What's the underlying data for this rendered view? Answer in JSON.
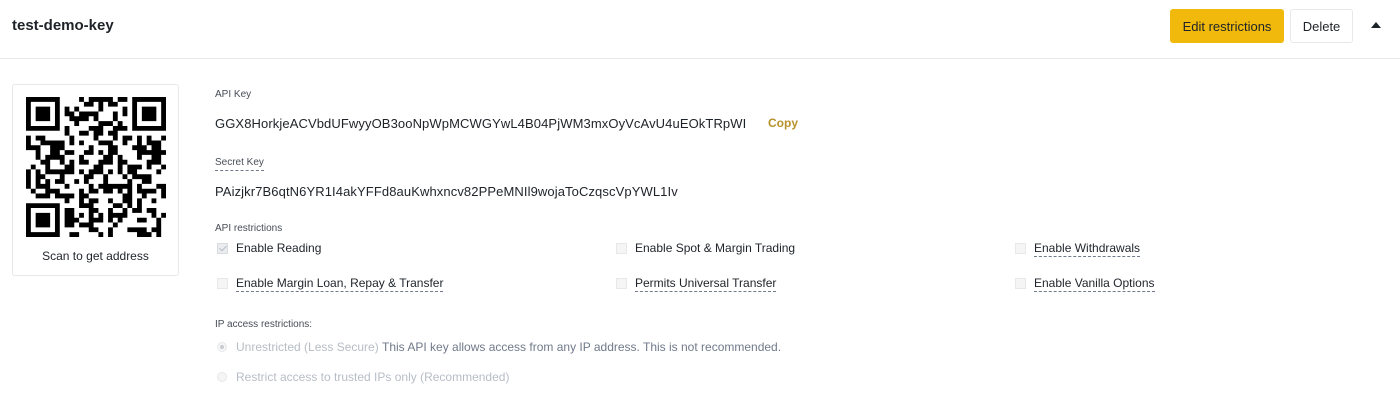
{
  "header": {
    "title": "test-demo-key",
    "edit_label": "Edit restrictions",
    "delete_label": "Delete"
  },
  "qr": {
    "caption": "Scan to get address"
  },
  "api_key": {
    "label": "API Key",
    "value": "GGX8HorkjeACVbdUFwyyOB3ooNpWpMCWGYwL4B04PjWM3mxOyVcAvU4uEOkTRpWI",
    "copy_label": "Copy"
  },
  "secret_key": {
    "label": "Secret Key",
    "value": "PAizjkr7B6qtN6YR1I4akYFFd8auKwhxncv82PPeMNIl9wojaToCzqscVpYWL1Iv"
  },
  "restrictions": {
    "label": "API restrictions",
    "items": [
      {
        "label": "Enable Reading",
        "checked": true
      },
      {
        "label": "Enable Spot & Margin Trading",
        "checked": false
      },
      {
        "label": "Enable Withdrawals",
        "checked": false
      },
      {
        "label": "Enable Margin Loan, Repay & Transfer",
        "checked": false
      },
      {
        "label": "Permits Universal Transfer",
        "checked": false
      },
      {
        "label": "Enable Vanilla Options",
        "checked": false
      }
    ]
  },
  "ip_access": {
    "label": "IP access restrictions:",
    "options": [
      {
        "label": "Unrestricted (Less Secure)",
        "description": "This API key allows access from any IP address. This is not recommended.",
        "selected": true
      },
      {
        "label": "Restrict access to trusted IPs only (Recommended)",
        "description": "",
        "selected": false
      }
    ]
  },
  "colors": {
    "accent": "#f0b90b",
    "copy": "#b7922b",
    "text": "#1e2329",
    "border": "#e6e8ea"
  },
  "icons": {
    "caret": "caret-up-icon",
    "qr": "qr-code-icon"
  }
}
